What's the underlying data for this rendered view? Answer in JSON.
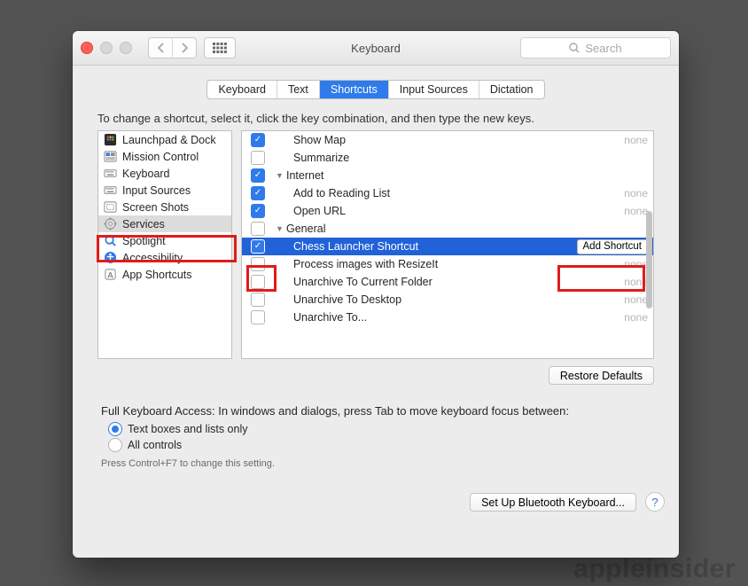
{
  "window": {
    "title": "Keyboard",
    "search_placeholder": "Search"
  },
  "tabs": [
    "Keyboard",
    "Text",
    "Shortcuts",
    "Input Sources",
    "Dictation"
  ],
  "active_tab_index": 2,
  "instructions": "To change a shortcut, select it, click the key combination, and then type the new keys.",
  "sidebar": {
    "items": [
      {
        "label": "Launchpad & Dock",
        "icon": "launchpad"
      },
      {
        "label": "Mission Control",
        "icon": "mission"
      },
      {
        "label": "Keyboard",
        "icon": "keyboard"
      },
      {
        "label": "Input Sources",
        "icon": "keyboard"
      },
      {
        "label": "Screen Shots",
        "icon": "screenshot"
      },
      {
        "label": "Services",
        "icon": "gear"
      },
      {
        "label": "Spotlight",
        "icon": "spotlight"
      },
      {
        "label": "Accessibility",
        "icon": "accessibility"
      },
      {
        "label": "App Shortcuts",
        "icon": "appshort"
      }
    ],
    "selected_index": 5
  },
  "shortcut_rows": [
    {
      "type": "item",
      "checked": true,
      "label": "Show Map",
      "value": "none"
    },
    {
      "type": "item",
      "checked": false,
      "label": "Summarize",
      "value": ""
    },
    {
      "type": "cat",
      "checked": true,
      "label": "Internet"
    },
    {
      "type": "item",
      "checked": true,
      "label": "Add to Reading List",
      "value": "none"
    },
    {
      "type": "item",
      "checked": true,
      "label": "Open URL",
      "value": "none"
    },
    {
      "type": "cat",
      "checked": false,
      "label": "General"
    },
    {
      "type": "item",
      "checked": true,
      "label": "Chess Launcher Shortcut",
      "value": "",
      "selected": true,
      "button": "Add Shortcut"
    },
    {
      "type": "item",
      "checked": false,
      "label": "Process images with ResizeIt",
      "value": "none"
    },
    {
      "type": "item",
      "checked": false,
      "label": "Unarchive To Current Folder",
      "value": "none"
    },
    {
      "type": "item",
      "checked": false,
      "label": "Unarchive To Desktop",
      "value": "none"
    },
    {
      "type": "item",
      "checked": false,
      "label": "Unarchive To...",
      "value": "none"
    }
  ],
  "restore_label": "Restore Defaults",
  "fka": {
    "heading": "Full Keyboard Access: In windows and dialogs, press Tab to move keyboard focus between:",
    "options": [
      "Text boxes and lists only",
      "All controls"
    ],
    "selected": 0,
    "hint": "Press Control+F7 to change this setting."
  },
  "footer": {
    "bluetooth": "Set Up Bluetooth Keyboard..."
  },
  "watermark": "appleinsider"
}
